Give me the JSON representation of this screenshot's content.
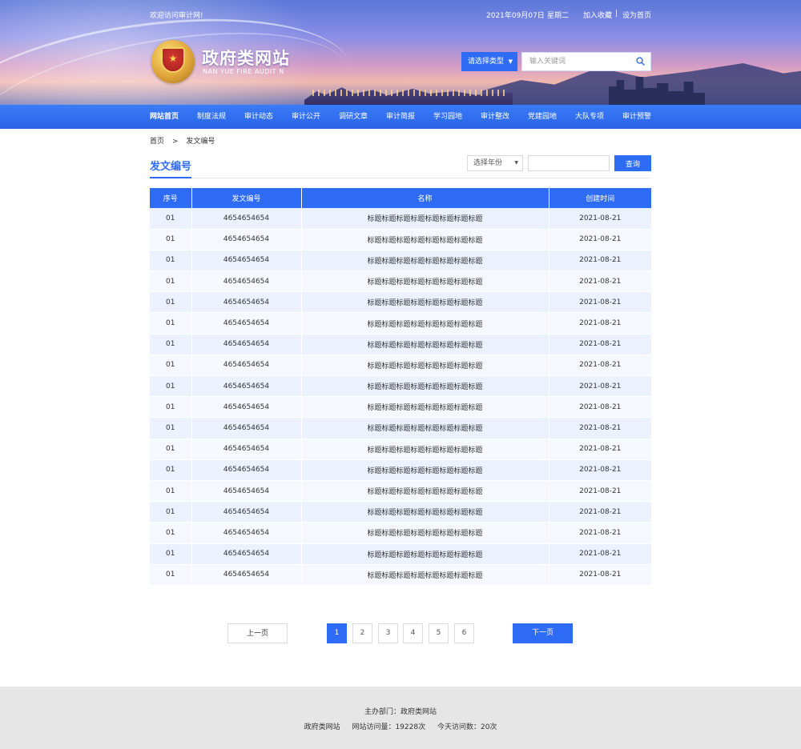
{
  "topbar": {
    "welcome": "欢迎访问审计网!",
    "date": "2021年09月07日",
    "weekday": "星期二",
    "add_favorite": "加入收藏",
    "separator": "|",
    "set_home": "设为首页"
  },
  "header": {
    "title": "政府类网站",
    "subtitle": "NAN YUE FIRE AUDIT N",
    "emblem_glyph": "★"
  },
  "search": {
    "type_label": "请选择类型",
    "type_caret": "▼",
    "placeholder": "输入关键词",
    "icon": "search-icon"
  },
  "nav": {
    "items": [
      {
        "label": "网站首页",
        "active": true
      },
      {
        "label": "制度法规"
      },
      {
        "label": "审计动态"
      },
      {
        "label": "审计公开"
      },
      {
        "label": "调研文章"
      },
      {
        "label": "审计简报"
      },
      {
        "label": "学习园地"
      },
      {
        "label": "审计整改"
      },
      {
        "label": "党建园地"
      },
      {
        "label": "大队专项"
      },
      {
        "label": "审计预警"
      }
    ]
  },
  "breadcrumb": {
    "home": "首页",
    "separator": ">",
    "current": "发文编号"
  },
  "section": {
    "title": "发文编号",
    "year_select": "选择年份",
    "year_caret": "▼",
    "query_value": "",
    "query_button": "查询"
  },
  "table": {
    "headers": [
      "序号",
      "发文编号",
      "名称",
      "创建时间"
    ],
    "rows": [
      [
        "01",
        "4654654654",
        "标题标题标题标题标题标题标题标题",
        "2021-08-21"
      ],
      [
        "01",
        "4654654654",
        "标题标题标题标题标题标题标题标题",
        "2021-08-21"
      ],
      [
        "01",
        "4654654654",
        "标题标题标题标题标题标题标题标题",
        "2021-08-21"
      ],
      [
        "01",
        "4654654654",
        "标题标题标题标题标题标题标题标题",
        "2021-08-21"
      ],
      [
        "01",
        "4654654654",
        "标题标题标题标题标题标题标题标题",
        "2021-08-21"
      ],
      [
        "01",
        "4654654654",
        "标题标题标题标题标题标题标题标题",
        "2021-08-21"
      ],
      [
        "01",
        "4654654654",
        "标题标题标题标题标题标题标题标题",
        "2021-08-21"
      ],
      [
        "01",
        "4654654654",
        "标题标题标题标题标题标题标题标题",
        "2021-08-21"
      ],
      [
        "01",
        "4654654654",
        "标题标题标题标题标题标题标题标题",
        "2021-08-21"
      ],
      [
        "01",
        "4654654654",
        "标题标题标题标题标题标题标题标题",
        "2021-08-21"
      ],
      [
        "01",
        "4654654654",
        "标题标题标题标题标题标题标题标题",
        "2021-08-21"
      ],
      [
        "01",
        "4654654654",
        "标题标题标题标题标题标题标题标题",
        "2021-08-21"
      ],
      [
        "01",
        "4654654654",
        "标题标题标题标题标题标题标题标题",
        "2021-08-21"
      ],
      [
        "01",
        "4654654654",
        "标题标题标题标题标题标题标题标题",
        "2021-08-21"
      ],
      [
        "01",
        "4654654654",
        "标题标题标题标题标题标题标题标题",
        "2021-08-21"
      ],
      [
        "01",
        "4654654654",
        "标题标题标题标题标题标题标题标题",
        "2021-08-21"
      ],
      [
        "01",
        "4654654654",
        "标题标题标题标题标题标题标题标题",
        "2021-08-21"
      ],
      [
        "01",
        "4654654654",
        "标题标题标题标题标题标题标题标题",
        "2021-08-21"
      ]
    ]
  },
  "pagination": {
    "prev": "上一页",
    "next": "下一页",
    "pages": [
      "1",
      "2",
      "3",
      "4",
      "5",
      "6"
    ],
    "current": "1"
  },
  "footer": {
    "sponsor": "主办部门：政府类网站",
    "site_name": "政府类网站",
    "total_visits": "网站访问量：19228次",
    "today_visits": "今天访问数：20次"
  },
  "colors": {
    "primary": "#2f6cf5",
    "row_odd": "#ebf1fd",
    "row_even": "#f5f8fe",
    "footer_bg": "#e6e6e6"
  }
}
